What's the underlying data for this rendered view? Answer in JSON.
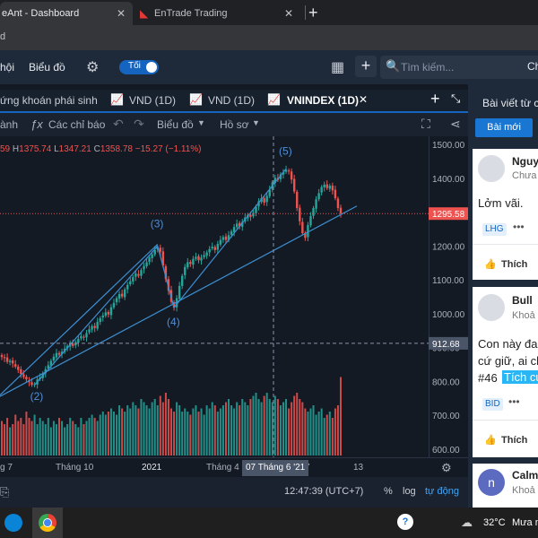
{
  "browser": {
    "tabs": [
      {
        "title": "eAnt - Dashboard"
      },
      {
        "title": "EnTrade Trading"
      }
    ],
    "address": "d"
  },
  "header": {
    "nav": [
      "hội",
      "Biểu đồ"
    ],
    "toggle_label": "Tối",
    "search_placeholder": "Tìm kiếm...",
    "user_initial": "Ch"
  },
  "chart_tabs": [
    "ứng khoán phái sinh",
    "VND (1D)",
    "VND (1D)",
    "VNINDEX (1D)"
  ],
  "toolbar": {
    "drawing": "ành",
    "indicators": "Các chỉ báo",
    "chart_menu": "Biểu đồ",
    "profile_menu": "Hồ sơ"
  },
  "ohlc": {
    "open_tail": "59",
    "high_label": "H",
    "high": "1375.74",
    "low_label": "L",
    "low": "1347.21",
    "close_label": "C",
    "close": "1358.78",
    "change": "−15.27 (−1.11%)"
  },
  "chart_data": {
    "type": "candlestick",
    "price_axis_ticks": [
      1500,
      1400,
      1300,
      1200,
      1100,
      1000,
      900,
      800,
      700,
      600
    ],
    "price_axis_labels": [
      "1500.00",
      "1400.00",
      "1300.00",
      "1200.00",
      "1100.00",
      "1000.00",
      "900.00",
      "800.00",
      "700.00",
      "600.00"
    ],
    "ylim": [
      590,
      1520
    ],
    "x_labels": [
      "g 7",
      "Tháng 10",
      "2021",
      "Tháng 4",
      "7",
      "13"
    ],
    "current_price_label": "1295.58",
    "crosshair_price_label": "912.68",
    "crosshair_date_label": "07 Tháng 6 '21",
    "wave_labels": [
      "(2)",
      "(3)",
      "(4)",
      "(5)"
    ],
    "close_series": [
      872,
      869,
      858,
      861,
      853,
      844,
      834,
      822,
      813,
      806,
      798,
      790,
      792,
      806,
      812,
      824,
      836,
      848,
      861,
      873,
      884,
      879,
      888,
      897,
      905,
      912,
      905,
      916,
      926,
      934,
      930,
      943,
      954,
      963,
      958,
      976,
      987,
      995,
      1004,
      998,
      1019,
      1032,
      1046,
      1058,
      1051,
      1072,
      1085,
      1096,
      1108,
      1119,
      1112,
      1129,
      1141,
      1152,
      1166,
      1175,
      1188,
      1196,
      1183,
      1142,
      1102,
      1068,
      1035,
      1018,
      1046,
      1082,
      1112,
      1138,
      1152,
      1147,
      1162,
      1168,
      1158,
      1166,
      1173,
      1181,
      1191,
      1198,
      1188,
      1206,
      1218,
      1226,
      1218,
      1232,
      1243,
      1256,
      1266,
      1258,
      1271,
      1284,
      1292,
      1286,
      1298,
      1316,
      1332,
      1341,
      1328,
      1348,
      1366,
      1388,
      1401,
      1395,
      1412,
      1418,
      1425,
      1420,
      1396,
      1361,
      1312,
      1273,
      1238,
      1224,
      1262,
      1288,
      1312,
      1338,
      1356,
      1374,
      1381,
      1371,
      1378,
      1364,
      1341,
      1312,
      1296
    ],
    "volume_scale": [
      0.55,
      0.5,
      0.6,
      0.45,
      0.5,
      0.65,
      0.55,
      0.6,
      0.5,
      0.7,
      0.6,
      0.55,
      0.65,
      0.5,
      0.6,
      0.55,
      0.5,
      0.6,
      0.45,
      0.55,
      0.5,
      0.6,
      0.55,
      0.45,
      0.5,
      0.6,
      0.55,
      0.5,
      0.45,
      0.6,
      0.5,
      0.55,
      0.6,
      0.65,
      0.6,
      0.55,
      0.65,
      0.7,
      0.65,
      0.7,
      0.75,
      0.7,
      0.65,
      0.8,
      0.75,
      0.7,
      0.8,
      0.75,
      0.85,
      0.8,
      0.75,
      0.9,
      0.85,
      0.8,
      0.75,
      0.85,
      0.9,
      0.8,
      0.95,
      0.85,
      1.0,
      0.9,
      0.75,
      0.7,
      0.85,
      0.8,
      0.7,
      0.75,
      0.7,
      0.65,
      0.75,
      0.8,
      0.7,
      0.75,
      0.65,
      0.8,
      0.75,
      0.85,
      0.8,
      0.7,
      0.75,
      0.8,
      0.85,
      0.9,
      0.8,
      0.75,
      0.85,
      0.8,
      0.9,
      0.85,
      0.8,
      0.9,
      0.95,
      1.0,
      0.9,
      0.85,
      0.95,
      1.0,
      0.9,
      0.85,
      0.95,
      0.9,
      0.8,
      0.85,
      0.9,
      0.75,
      0.85,
      0.95,
      1.0,
      0.9,
      0.85,
      0.75,
      0.7,
      0.75,
      0.8,
      0.65,
      0.7,
      0.75,
      0.6,
      0.65,
      0.7,
      0.6,
      0.75,
      0.8,
      1.25
    ]
  },
  "bottom": {
    "time": "12:47:39 (UTC+7)",
    "percent": "%",
    "log": "log",
    "auto": "tự động"
  },
  "right_panel": {
    "title": "Bài viết từ c",
    "tab_new": "Bài mới",
    "posts": [
      {
        "name": "Nguy",
        "status": "Chưa",
        "content": "Lởm vãi.",
        "tag": "LHG",
        "like": "Thích"
      },
      {
        "name": "Bull",
        "status": "Khoả",
        "content_line1": "Con này đan",
        "content_line2": "cứ giữ, ai ch",
        "content_line3": "#46",
        "highlight": "Tích cu",
        "tag": "BID",
        "like": "Thích"
      },
      {
        "initial": "n",
        "name": "Calm",
        "status": "Khoả"
      }
    ]
  },
  "taskbar": {
    "weather_temp": "32°C",
    "weather_text": "Mưa n"
  },
  "colors": {
    "up": "#26a69a",
    "down": "#ef5350",
    "trendline": "#3d8fd1",
    "accent": "#1565c0"
  }
}
